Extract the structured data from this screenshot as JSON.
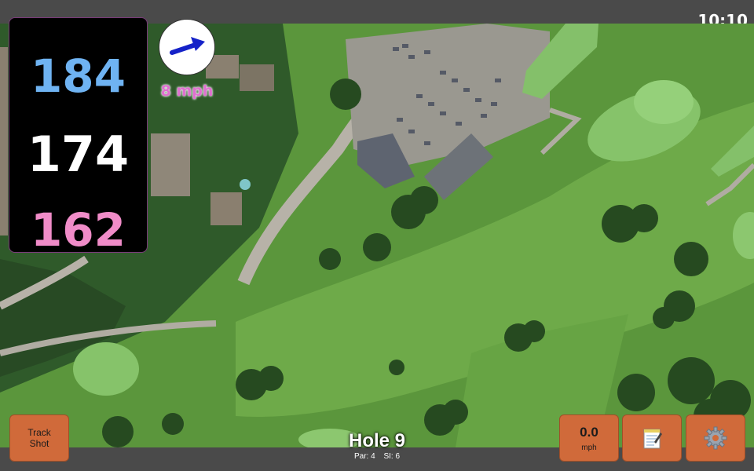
{
  "status_bar": {
    "time": "10:10"
  },
  "distances": {
    "back": "184",
    "center": "174",
    "front": "162"
  },
  "wind": {
    "speed_label": "8 mph",
    "direction_icon": "arrow-icon"
  },
  "buttons": {
    "track_shot_label_line1": "Track",
    "track_shot_label_line2": "Shot",
    "wind_value": "0.0",
    "wind_unit": "mph",
    "notes_icon": "notepad-icon",
    "settings_icon": "gear-icon"
  },
  "hole": {
    "title": "Hole 9",
    "par": "Par: 4",
    "si": "SI: 6"
  },
  "colors": {
    "back_distance": "#6fb3f2",
    "center_distance": "#ffffff",
    "front_distance": "#f08cc8",
    "button_bg": "#d06a3a",
    "wind_text": "#e070d0"
  }
}
